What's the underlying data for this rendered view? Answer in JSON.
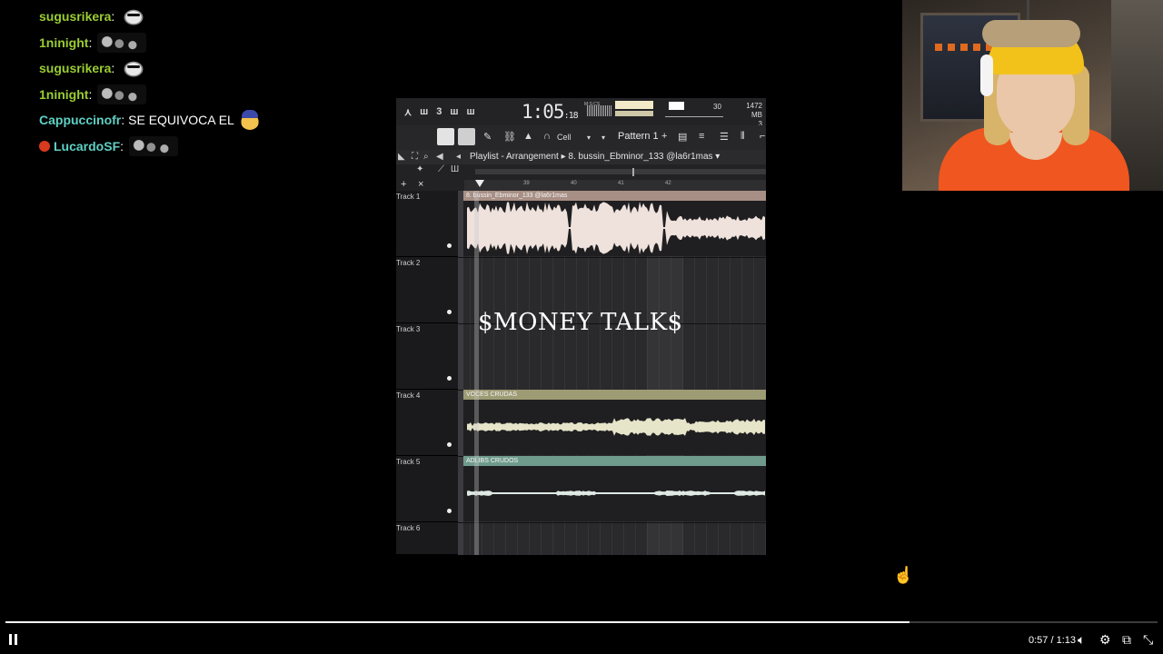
{
  "chat": {
    "messages": [
      {
        "user": "sugusrikera",
        "color": "#9acd32",
        "text": "",
        "emote": "ghost-emote",
        "badge": false
      },
      {
        "user": "1ninight",
        "color": "#9acd32",
        "text": "",
        "emote": "group-emote",
        "badge": false
      },
      {
        "user": "sugusrikera",
        "color": "#9acd32",
        "text": "",
        "emote": "ghost-emote",
        "badge": false
      },
      {
        "user": "1ninight",
        "color": "#9acd32",
        "text": "",
        "emote": "group-emote",
        "badge": false
      },
      {
        "user": "Cappuccinofr",
        "color": "#5fd0c4",
        "text": "SE EQUIVOCA EL",
        "emote": "face-emote",
        "badge": false
      },
      {
        "user": "LucardoSF",
        "color": "#5fd0c4",
        "text": "",
        "emote": "group-emote",
        "badge": true
      }
    ]
  },
  "daw": {
    "time_main": "1:05",
    "time_sub": "18",
    "time_unit": "M:S:CS",
    "slider_value": "30",
    "memory_line1": "1472 MB",
    "memory_line2": "3",
    "cell_label": "Cell",
    "pattern_label": "Pattern 1",
    "playlist_title": "Playlist - Arrangement ▸ 8. bussin_Ebminor_133 @la6r1mas ▾",
    "ruler_numbers": [
      "39",
      "40",
      "41",
      "42"
    ],
    "tracks": [
      "Track 1",
      "Track 2",
      "Track 3",
      "Track 4",
      "Track 5",
      "Track 6"
    ],
    "clips": [
      {
        "name": "8. bussin_Ebminor_133 @la6r1mas",
        "header_color": "#a88f85",
        "wave_color": "#efe2dc"
      },
      {
        "name": "VOCES CRUDAS",
        "header_color": "#9d9b74",
        "wave_color": "#e6e4c9"
      },
      {
        "name": "ADLIBS CRUDOS",
        "header_color": "#6f9b8c",
        "wave_color": "#dfe9e3"
      }
    ],
    "overlay_title": "$MONEY TALK$"
  },
  "player": {
    "current_time": "0:57",
    "duration": "1:13",
    "progress": 0.785
  },
  "icons": [
    "pause-icon",
    "volume-icon",
    "settings-icon",
    "popout-icon",
    "fullscreen-exit-icon"
  ]
}
